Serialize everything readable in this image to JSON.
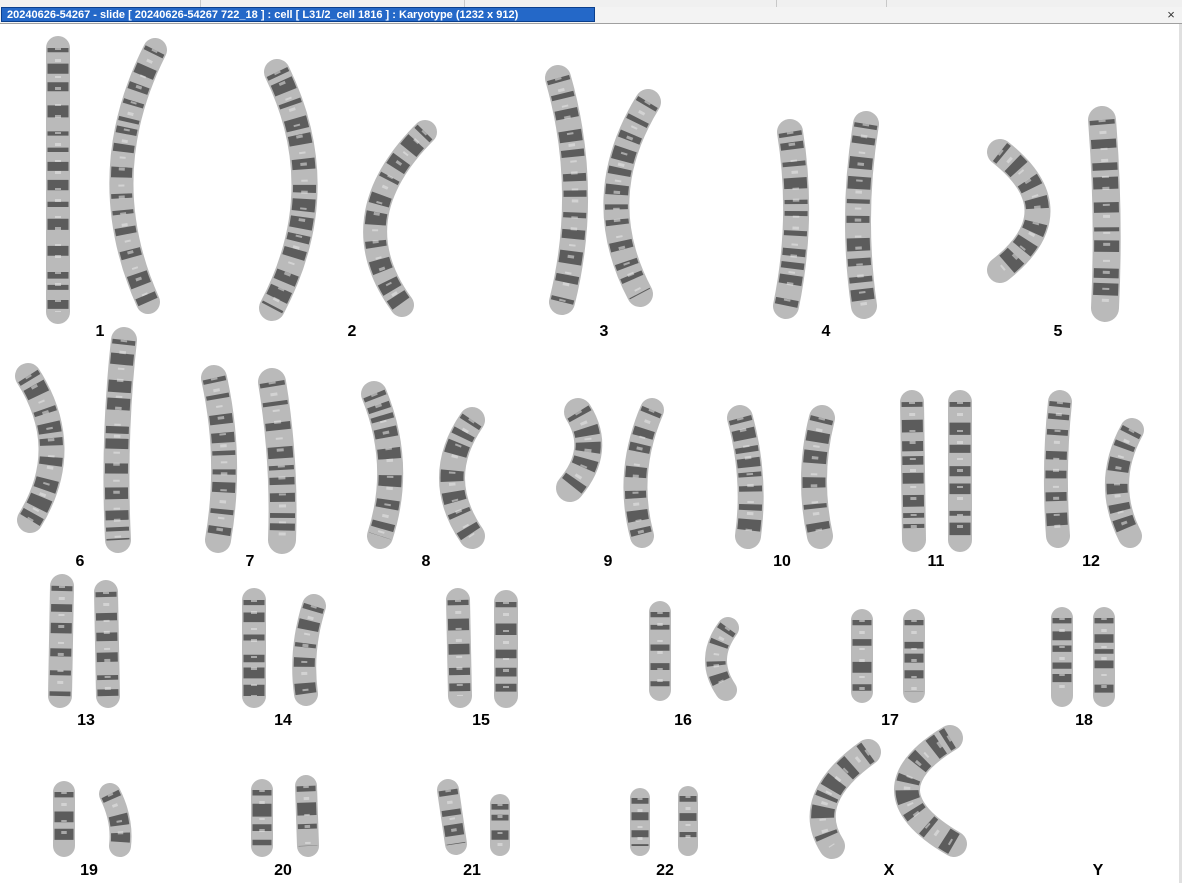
{
  "window": {
    "title": "20240626-54267 - slide [ 20240626-54267 722_18 ] : cell [ L31/2_cell 1816 ] : Karyotype  (1232 x 912)",
    "close_symbol": "×"
  },
  "colors": {
    "title_bg": "#2468c8",
    "title_text": "#ffffff",
    "canvas_bg": "#ffffff",
    "chromosome_body": "#b2b2b2",
    "band_dark": "#3c3c3c"
  },
  "karyotype": {
    "chromosomes": [
      {
        "label": "1"
      },
      {
        "label": "2"
      },
      {
        "label": "3"
      },
      {
        "label": "4"
      },
      {
        "label": "5"
      },
      {
        "label": "6"
      },
      {
        "label": "7"
      },
      {
        "label": "8"
      },
      {
        "label": "9"
      },
      {
        "label": "10"
      },
      {
        "label": "11"
      },
      {
        "label": "12"
      },
      {
        "label": "13"
      },
      {
        "label": "14"
      },
      {
        "label": "15"
      },
      {
        "label": "16"
      },
      {
        "label": "17"
      },
      {
        "label": "18"
      },
      {
        "label": "19"
      },
      {
        "label": "20"
      },
      {
        "label": "21"
      },
      {
        "label": "22"
      },
      {
        "label": "X"
      },
      {
        "label": "Y"
      }
    ]
  }
}
